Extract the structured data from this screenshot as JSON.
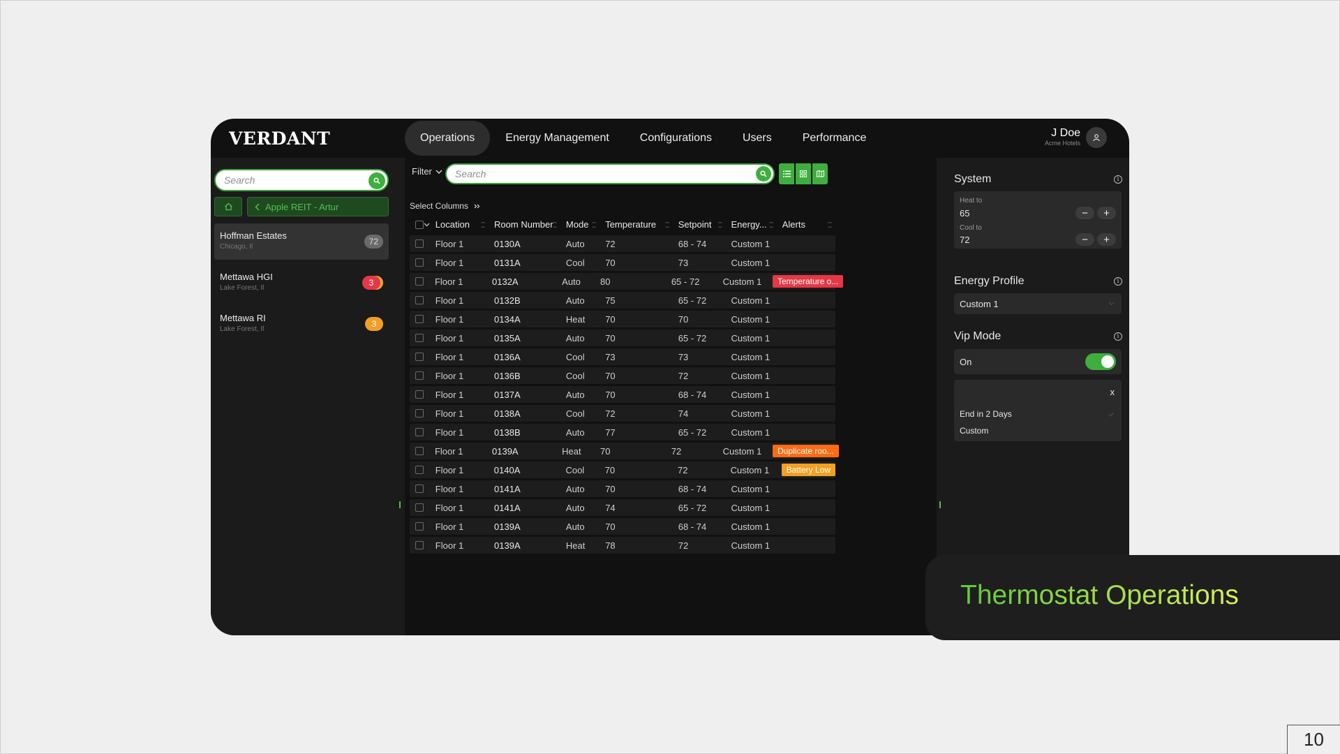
{
  "app": {
    "logo": "VERDANT"
  },
  "nav": [
    {
      "label": "Operations",
      "active": true
    },
    {
      "label": "Energy Management",
      "active": false
    },
    {
      "label": "Configurations",
      "active": false
    },
    {
      "label": "Users",
      "active": false
    },
    {
      "label": "Performance",
      "active": false
    }
  ],
  "user": {
    "name": "J Doe",
    "org": "Acme Hotels"
  },
  "sidebar": {
    "search_placeholder": "Search",
    "breadcrumb": "Apple REIT - Artur",
    "sites": [
      {
        "name": "Hoffman Estates",
        "sub": "Chicago, Il",
        "count": "72",
        "badge_color": "#6a6a6a"
      },
      {
        "name": "Mettawa HGI",
        "sub": "Lake Forest, Il",
        "count": "3",
        "badge_color": "#e53845"
      },
      {
        "name": "Mettawa RI",
        "sub": "Lake Forest, Il",
        "count": "3",
        "badge_color": "#f2a024"
      }
    ]
  },
  "toolbar": {
    "filter_label": "Filter",
    "search_placeholder": "Search",
    "select_columns": "Select Columns"
  },
  "table": {
    "columns": [
      "Location",
      "Room Number",
      "Mode",
      "Temperature",
      "Setpoint",
      "Energy...",
      "Alerts"
    ],
    "rows": [
      {
        "location": "Floor 1",
        "room": "0130A",
        "mode": "Auto",
        "temp": "72",
        "setpoint": "68 - 74",
        "energy": "Custom 1",
        "alert": ""
      },
      {
        "location": "Floor 1",
        "room": "0131A",
        "mode": "Cool",
        "temp": "70",
        "setpoint": "73",
        "energy": "Custom 1",
        "alert": ""
      },
      {
        "location": "Floor 1",
        "room": "0132A",
        "mode": "Auto",
        "temp": "80",
        "setpoint": "65 - 72",
        "energy": "Custom 1",
        "alert": "Temperature o...",
        "alert_type": "red"
      },
      {
        "location": "Floor 1",
        "room": "0132B",
        "mode": "Auto",
        "temp": "75",
        "setpoint": "65 - 72",
        "energy": "Custom 1",
        "alert": ""
      },
      {
        "location": "Floor 1",
        "room": "0134A",
        "mode": "Heat",
        "temp": "70",
        "setpoint": "70",
        "energy": "Custom 1",
        "alert": ""
      },
      {
        "location": "Floor 1",
        "room": "0135A",
        "mode": "Auto",
        "temp": "70",
        "setpoint": "65 - 72",
        "energy": "Custom 1",
        "alert": ""
      },
      {
        "location": "Floor 1",
        "room": "0136A",
        "mode": "Cool",
        "temp": "73",
        "setpoint": "73",
        "energy": "Custom 1",
        "alert": ""
      },
      {
        "location": "Floor 1",
        "room": "0136B",
        "mode": "Cool",
        "temp": "70",
        "setpoint": "72",
        "energy": "Custom 1",
        "alert": ""
      },
      {
        "location": "Floor 1",
        "room": "0137A",
        "mode": "Auto",
        "temp": "70",
        "setpoint": "68 - 74",
        "energy": "Custom 1",
        "alert": ""
      },
      {
        "location": "Floor 1",
        "room": "0138A",
        "mode": "Cool",
        "temp": "72",
        "setpoint": "74",
        "energy": "Custom 1",
        "alert": ""
      },
      {
        "location": "Floor 1",
        "room": "0138B",
        "mode": "Auto",
        "temp": "77",
        "setpoint": "65 - 72",
        "energy": "Custom 1",
        "alert": ""
      },
      {
        "location": "Floor 1",
        "room": "0139A",
        "mode": "Heat",
        "temp": "70",
        "setpoint": "72",
        "energy": "Custom 1",
        "alert": "Duplicate roo...",
        "alert_type": "orange"
      },
      {
        "location": "Floor 1",
        "room": "0140A",
        "mode": "Cool",
        "temp": "70",
        "setpoint": "72",
        "energy": "Custom 1",
        "alert": "Battery Low",
        "alert_type": "amber"
      },
      {
        "location": "Floor 1",
        "room": "0141A",
        "mode": "Auto",
        "temp": "70",
        "setpoint": "68 - 74",
        "energy": "Custom 1",
        "alert": ""
      },
      {
        "location": "Floor 1",
        "room": "0141A",
        "mode": "Auto",
        "temp": "74",
        "setpoint": "65 - 72",
        "energy": "Custom 1",
        "alert": ""
      },
      {
        "location": "Floor 1",
        "room": "0139A",
        "mode": "Auto",
        "temp": "70",
        "setpoint": "68 - 74",
        "energy": "Custom 1",
        "alert": ""
      },
      {
        "location": "Floor 1",
        "room": "0139A",
        "mode": "Heat",
        "temp": "78",
        "setpoint": "72",
        "energy": "Custom 1",
        "alert": ""
      }
    ]
  },
  "panel": {
    "system": {
      "title": "System",
      "heat_label": "Heat to",
      "heat_value": "65",
      "cool_label": "Cool to",
      "cool_value": "72"
    },
    "energy": {
      "title": "Energy Profile",
      "value": "Custom 1"
    },
    "vip": {
      "title": "Vip Mode",
      "state": "On",
      "enabled": true,
      "close": "x",
      "options": [
        "End in 2 Days",
        "Custom"
      ]
    }
  },
  "banner": {
    "text": "Thermostat Operations"
  },
  "page_number": "10",
  "colors": {
    "accent": "#3fae3f",
    "alert_red": "#e53845",
    "alert_orange": "#ff6b12",
    "alert_amber": "#f2a024"
  }
}
